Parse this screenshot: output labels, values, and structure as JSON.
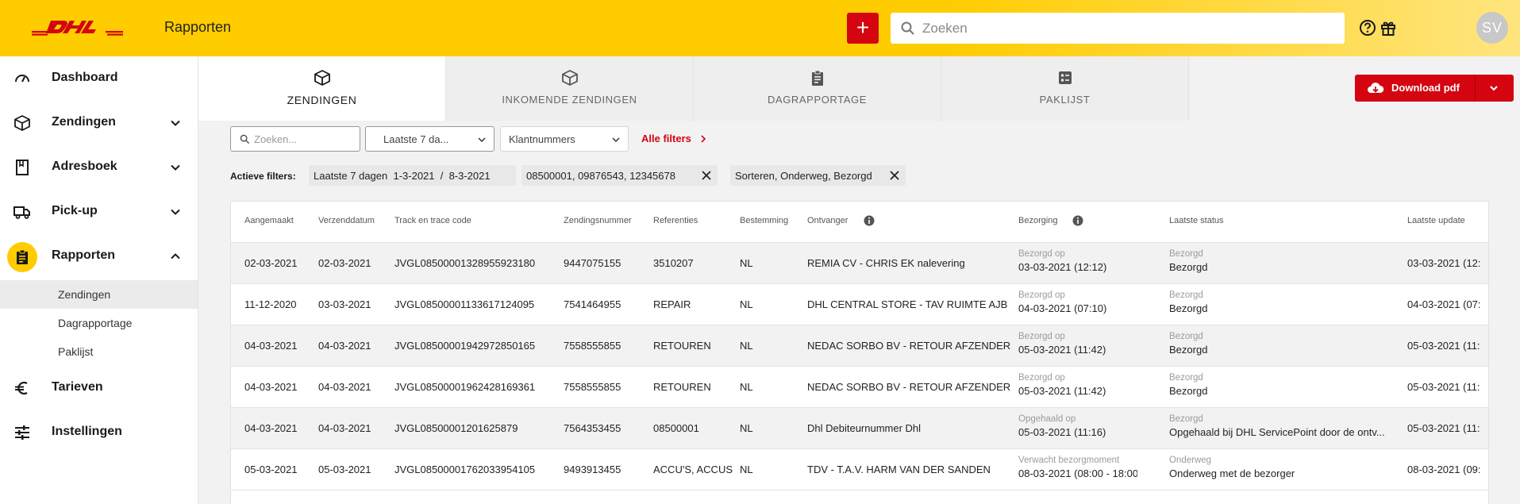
{
  "header": {
    "title": "Rapporten",
    "search_placeholder": "Zoeken",
    "add_label": "+",
    "avatar_initials": "SV",
    "brand_color": "#ffcc00",
    "accent_color": "#d40511"
  },
  "sidebar": {
    "items": [
      {
        "label": "Dashboard",
        "icon": "speedometer-icon"
      },
      {
        "label": "Zendingen",
        "icon": "package-icon"
      },
      {
        "label": "Adresboek",
        "icon": "book-icon"
      },
      {
        "label": "Pick-up",
        "icon": "truck-icon"
      },
      {
        "label": "Rapporten",
        "icon": "clipboard-icon"
      },
      {
        "label": "Tarieven",
        "icon": "euro-icon"
      },
      {
        "label": "Instellingen",
        "icon": "sliders-icon"
      }
    ],
    "sub_items": [
      "Zendingen",
      "Dagrapportage",
      "Paklijst"
    ]
  },
  "tabs": [
    {
      "label": "ZENDINGEN",
      "icon": "package-icon"
    },
    {
      "label": "INKOMENDE ZENDINGEN",
      "icon": "package-icon"
    },
    {
      "label": "DAGRAPPORTAGE",
      "icon": "clipboard-icon"
    },
    {
      "label": "PAKLIJST",
      "icon": "list-icon"
    }
  ],
  "download": {
    "label": "Download pdf",
    "icon": "cloud-download-icon"
  },
  "filters": {
    "search_placeholder": "Zoeken...",
    "date_value": "Laatste 7 da...",
    "klant_value": "Klantnummers",
    "all_filters": "Alle filters",
    "active_label": "Actieve filters:",
    "chip_date": "Laatste 7 dagen  1-3-2021  /  8-3-2021",
    "chip_numbers": "08500001, 09876543, 12345678",
    "chip_status": "Sorteren, Onderweg, Bezorgd"
  },
  "table": {
    "headers": {
      "aangemaakt": "Aangemaakt",
      "verzenddatum": "Verzenddatum",
      "track": "Track en trace code",
      "zendingsnummer": "Zendingsnummer",
      "referenties": "Referenties",
      "bestemming": "Bestemming",
      "ontvanger": "Ontvanger",
      "bezorging": "Bezorging",
      "status": "Laatste status",
      "update": "Laatste update"
    },
    "rows": [
      {
        "aangemaakt": "02-03-2021",
        "verzenddatum": "02-03-2021",
        "track": "JVGL08500001328955923180",
        "zendingsnummer": "9447075155",
        "referenties": "3510207",
        "bestemming": "NL",
        "ontvanger": "REMIA CV - CHRIS EK nalevering",
        "bezorging_label": "Bezorgd op",
        "bezorging_value": "03-03-2021 (12:12)",
        "status_label": "Bezorgd",
        "status_value": "Bezorgd",
        "update": "03-03-2021 (12:"
      },
      {
        "aangemaakt": "11-12-2020",
        "verzenddatum": "03-03-2021",
        "track": "JVGL08500001133617124095",
        "zendingsnummer": "7541464955",
        "referenties": "REPAIR",
        "bestemming": "NL",
        "ontvanger": "DHL CENTRAL STORE - TAV RUIMTE AJB",
        "bezorging_label": "Bezorgd op",
        "bezorging_value": "04-03-2021 (07:10)",
        "status_label": "Bezorgd",
        "status_value": "Bezorgd",
        "update": "04-03-2021 (07:"
      },
      {
        "aangemaakt": "04-03-2021",
        "verzenddatum": "04-03-2021",
        "track": "JVGL08500001942972850165",
        "zendingsnummer": "7558555855",
        "referenties": "RETOUREN",
        "bestemming": "NL",
        "ontvanger": "NEDAC SORBO BV - RETOUR AFZENDER",
        "bezorging_label": "Bezorgd op",
        "bezorging_value": "05-03-2021 (11:42)",
        "status_label": "Bezorgd",
        "status_value": "Bezorgd",
        "update": "05-03-2021 (11:"
      },
      {
        "aangemaakt": "04-03-2021",
        "verzenddatum": "04-03-2021",
        "track": "JVGL08500001962428169361",
        "zendingsnummer": "7558555855",
        "referenties": "RETOUREN",
        "bestemming": "NL",
        "ontvanger": "NEDAC SORBO BV - RETOUR AFZENDER",
        "bezorging_label": "Bezorgd op",
        "bezorging_value": "05-03-2021 (11:42)",
        "status_label": "Bezorgd",
        "status_value": "Bezorgd",
        "update": "05-03-2021 (11:"
      },
      {
        "aangemaakt": "04-03-2021",
        "verzenddatum": "04-03-2021",
        "track": "JVGL08500001201625879",
        "zendingsnummer": "7564353455",
        "referenties": "08500001",
        "bestemming": "NL",
        "ontvanger": "Dhl Debiteurnummer Dhl",
        "bezorging_label": "Opgehaald op",
        "bezorging_value": "05-03-2021 (11:16)",
        "status_label": "Bezorgd",
        "status_value": "Opgehaald bij DHL ServicePoint door de ontv...",
        "update": "05-03-2021 (11:"
      },
      {
        "aangemaakt": "05-03-2021",
        "verzenddatum": "05-03-2021",
        "track": "JVGL08500001762033954105",
        "zendingsnummer": "9493913455",
        "referenties": "ACCU'S, ACCUS",
        "bestemming": "NL",
        "ontvanger": "TDV - T.A.V. HARM VAN DER SANDEN",
        "bezorging_label": "Verwacht bezorgmoment",
        "bezorging_value": "08-03-2021 (08:00 - 18:00)",
        "status_label": "Onderweg",
        "status_value": "Onderweg met de bezorger",
        "update": "08-03-2021 (09:"
      }
    ]
  }
}
